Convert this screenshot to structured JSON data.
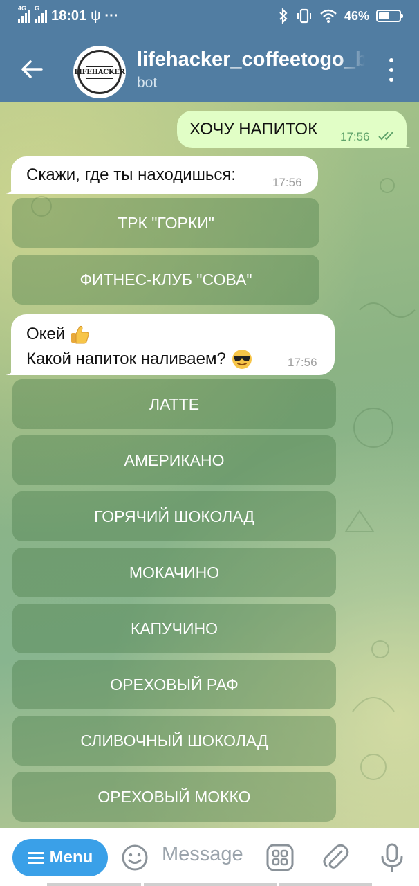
{
  "status_bar": {
    "network_1": "4G",
    "network_2": "G",
    "time": "18:01",
    "usb": "ψ",
    "more": "···",
    "battery": "46%",
    "battery_level": 0.46
  },
  "header": {
    "title": "lifehacker_coffeetogo_b",
    "subtitle": "bot",
    "avatar_text": "LIFEHACKER"
  },
  "messages": [
    {
      "direction": "out",
      "text": "ХОЧУ НАПИТОК",
      "time": "17:56",
      "status": "read"
    },
    {
      "direction": "in",
      "text": "Скажи, где ты находишься:",
      "time": "17:56"
    },
    {
      "direction": "in",
      "line1": "Окей",
      "line2": "Какой напиток наливаем?",
      "time": "17:56"
    }
  ],
  "location_buttons": [
    "ТРК \"ГОРКИ\"",
    "ФИТНЕС-КЛУБ \"СОВА\""
  ],
  "drink_buttons": [
    "ЛАТТЕ",
    "АМЕРИКАНО",
    "ГОРЯЧИЙ ШОКОЛАД",
    "МОКАЧИНО",
    "КАПУЧИНО",
    "ОРЕХОВЫЙ РАФ",
    "СЛИВОЧНЫЙ ШОКОЛАД",
    "ОРЕХОВЫЙ МОККО"
  ],
  "input_bar": {
    "menu_label": "Menu",
    "placeholder": "Message"
  },
  "colors": {
    "header": "#517da2",
    "outgoing_bubble": "#e1fec6",
    "menu_button": "#3aa0e8"
  }
}
